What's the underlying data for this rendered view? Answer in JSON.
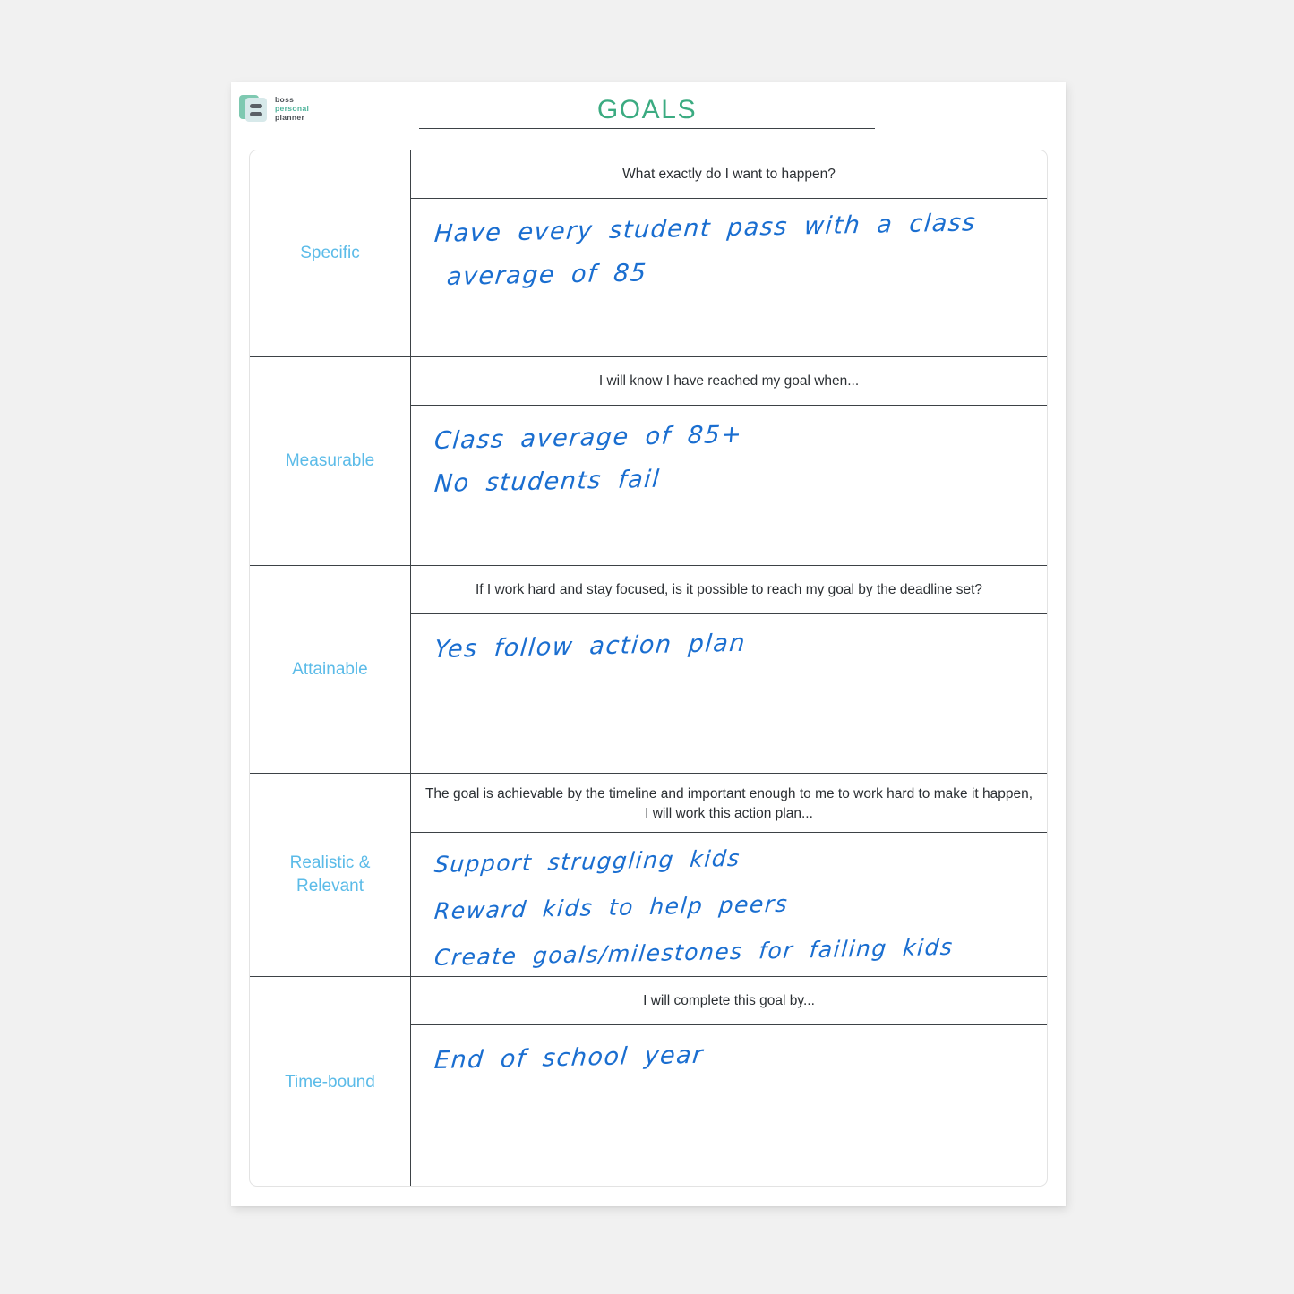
{
  "brand": {
    "line1": "boss",
    "line2": "personal",
    "line3": "planner",
    "icon": "stacked-document-icon",
    "accent_color": "#4db39a"
  },
  "header": {
    "title": "GOALS",
    "title_color": "#3bab81"
  },
  "colors": {
    "label": "#5bbbe8",
    "handwriting": "#1a6ed0",
    "rule": "#3d4246",
    "page_background": "#f1f1f1"
  },
  "rows": [
    {
      "label": "Specific",
      "prompt": "What exactly do I want to happen?",
      "answer_lines": [
        "Have every student pass with a class",
        "average of 85"
      ]
    },
    {
      "label": "Measurable",
      "prompt": "I will know I have reached my goal when...",
      "answer_lines": [
        "Class average of 85+",
        "No students fail"
      ]
    },
    {
      "label": "Attainable",
      "prompt": "If I work hard and stay focused, is it possible to reach my goal by the deadline set?",
      "answer_lines": [
        "Yes follow action plan"
      ]
    },
    {
      "label": "Realistic & Relevant",
      "prompt": "The goal is achievable by the timeline and important enough to me to work hard to make it happen, I will work this action plan...",
      "answer_lines": [
        "Support struggling kids",
        "Reward kids to help peers",
        "Create goals/milestones for failing kids"
      ]
    },
    {
      "label": "Time-bound",
      "prompt": "I will complete this goal by...",
      "answer_lines": [
        "End of school year"
      ]
    }
  ]
}
